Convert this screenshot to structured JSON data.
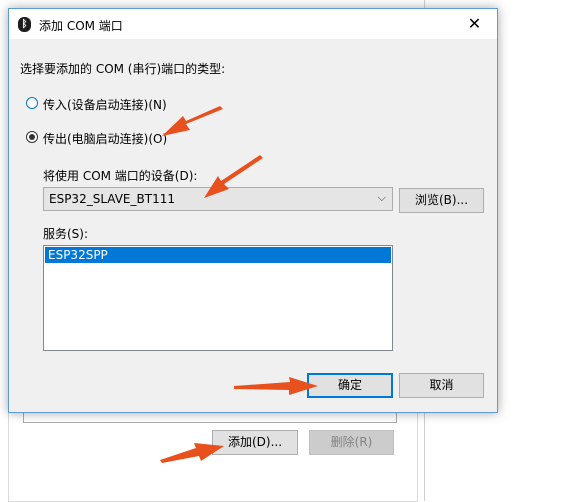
{
  "background_window": {
    "title_fragment": "...",
    "add_button": "添加(D)...",
    "remove_button": "删除(R)"
  },
  "dialog": {
    "title": "添加 COM 端口",
    "close_glyph": "✕",
    "prompt": "选择要添加的 COM (串行)端口的类型:",
    "radio_incoming": "传入(设备启动连接)(N)",
    "radio_outgoing": "传出(电脑启动连接)(O)",
    "selected_radio": "outgoing",
    "device_label": "将使用 COM 端口的设备(D):",
    "device_value": "ESP32_SLAVE_BT111",
    "browse_button": "浏览(B)...",
    "service_label": "服务(S):",
    "services": [
      "ESP32SPP"
    ],
    "ok_button": "确定",
    "cancel_button": "取消"
  },
  "colors": {
    "accent": "#0078d7",
    "annotation_arrow": "#e8501e",
    "dialog_bg": "#f0f0f0"
  },
  "icons": {
    "title_icon": "bluetooth-icon",
    "dropdown": "chevron-down-icon"
  }
}
